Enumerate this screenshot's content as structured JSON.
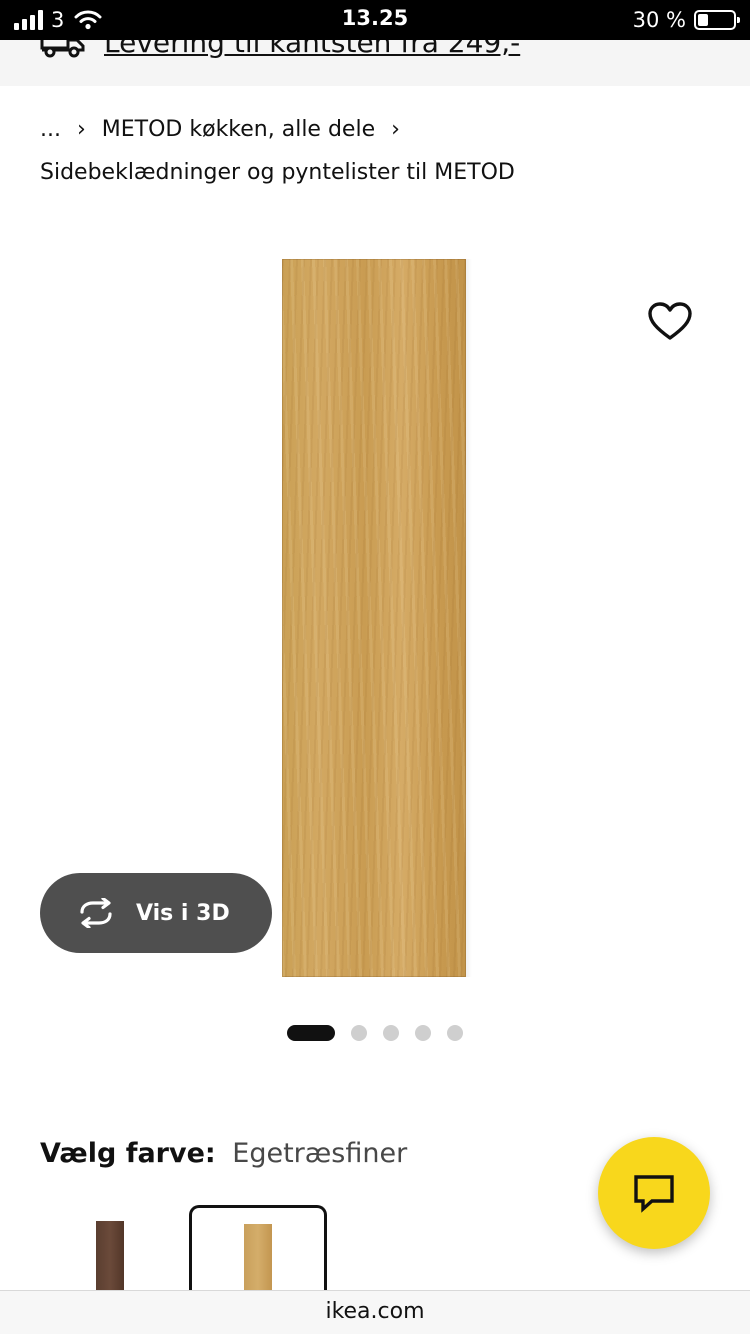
{
  "status_bar": {
    "carrier": "3",
    "time": "13.25",
    "battery_text": "30 %",
    "battery_level": 0.3
  },
  "delivery_banner": {
    "text": "Levering til kantsten fra 249,-",
    "icon": "truck-icon"
  },
  "breadcrumb": {
    "ellipsis": "...",
    "parent": "METOD køkken, alle dele",
    "separator_icon": "chevron-right-icon"
  },
  "page": {
    "subtitle": "Sidebeklædninger og pyntelister til METOD"
  },
  "product_image": {
    "wishlist_icon": "heart-icon",
    "view_3d_label": "Vis i 3D",
    "view_3d_icon": "rotate-icon",
    "pagination": {
      "total": 5,
      "active": 1
    }
  },
  "colour": {
    "label": "Vælg farve:",
    "selected": "Egetræsfiner",
    "swatches": [
      {
        "color": "#5e4233",
        "selected": false
      },
      {
        "color": "#cfa764",
        "selected": true
      }
    ]
  },
  "chat": {
    "icon": "chat-icon",
    "color": "#f8d71c"
  },
  "browser": {
    "url": "ikea.com"
  }
}
